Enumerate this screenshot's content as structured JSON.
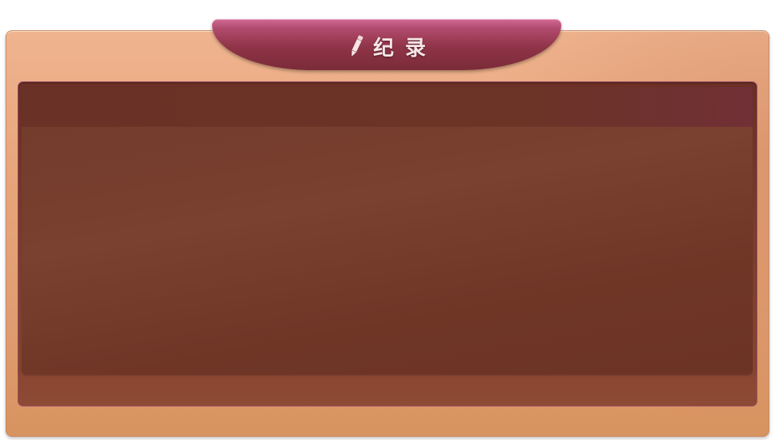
{
  "window": {
    "title": "纪录",
    "title_icon": "pencil-icon"
  },
  "record_panel": {
    "header_text": "",
    "body_text": ""
  },
  "colors": {
    "panel": "#e8a57c",
    "title_tab": "#8f3448",
    "content": "#733a2b"
  }
}
